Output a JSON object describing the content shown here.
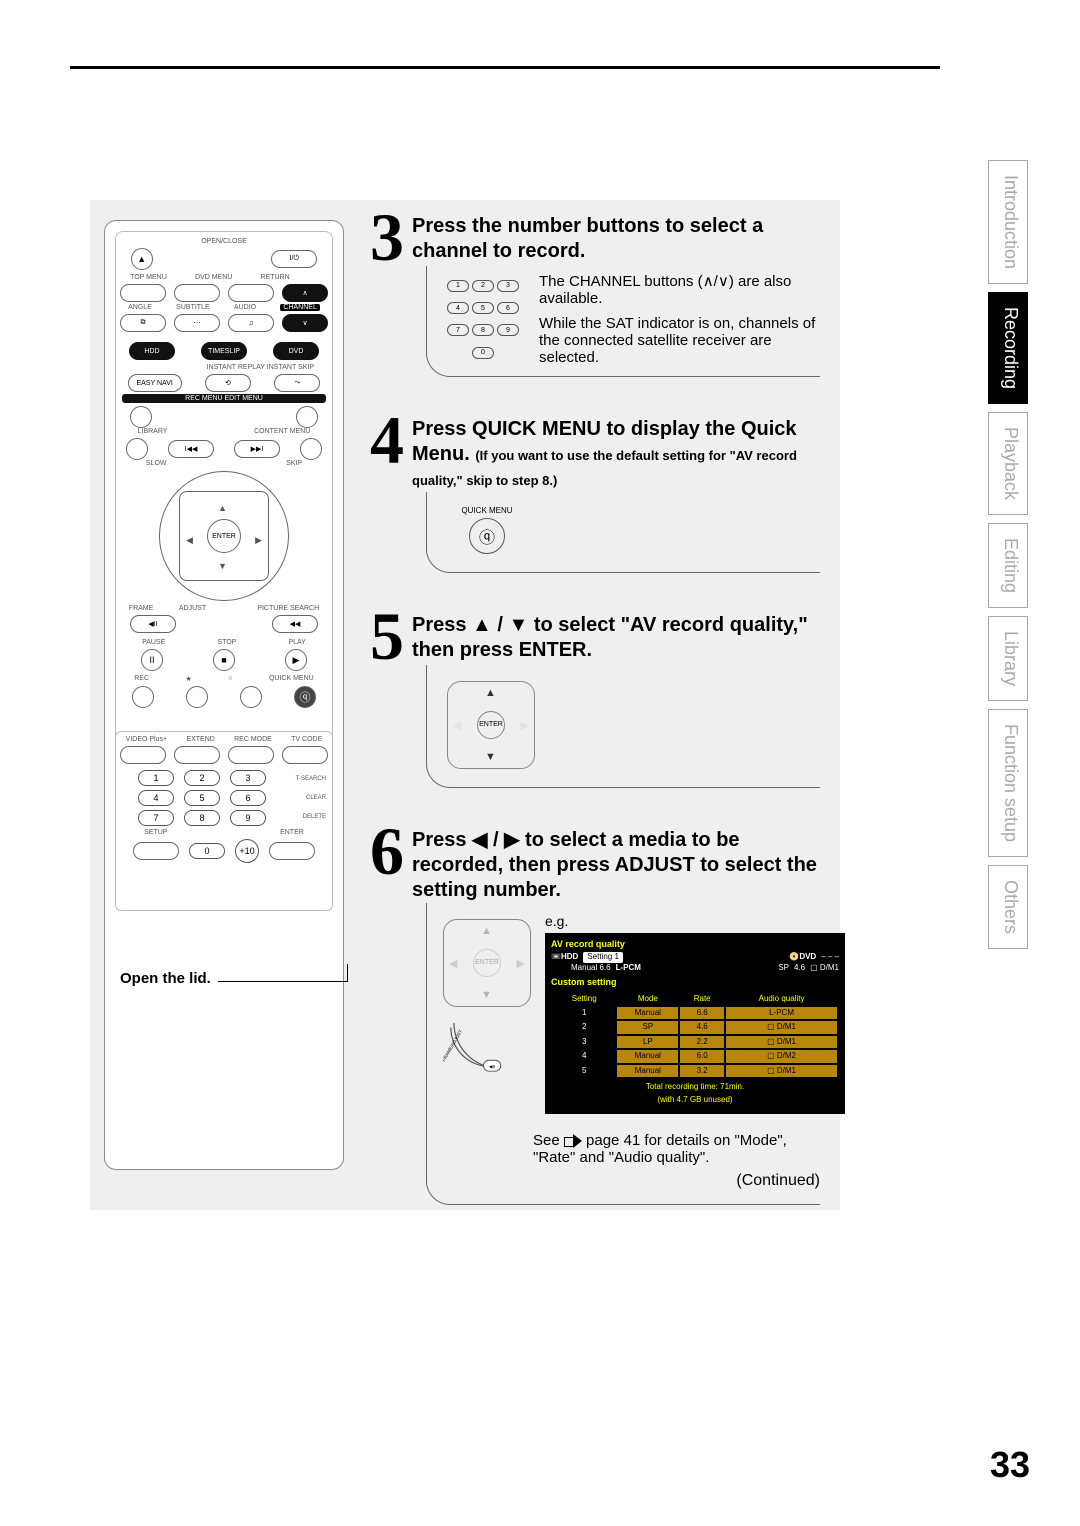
{
  "page_number": "33",
  "tabs": [
    "Introduction",
    "Recording",
    "Playback",
    "Editing",
    "Library",
    "Function setup",
    "Others"
  ],
  "active_tab_index": 1,
  "open_lid": "Open the lid.",
  "remote": {
    "top_labels": [
      "OPEN/CLOSE"
    ],
    "row2_labels": [
      "TOP MENU",
      "DVD MENU",
      "RETURN"
    ],
    "row3_labels": [
      "ANGLE",
      "SUBTITLE",
      "AUDIO",
      "CHANNEL"
    ],
    "drive_labels": [
      "HDD",
      "TIMESLIP",
      "DVD"
    ],
    "replay_label": "INSTANT REPLAY INSTANT SKIP",
    "easynavi": "EASY NAVI",
    "recmenu": "REC MENU  EDIT MENU",
    "library": "LIBRARY",
    "contentmenu": "CONTENT MENU",
    "slow": "SLOW",
    "skip": "SKIP",
    "enter": "ENTER",
    "frame": "FRAME",
    "adjust": "ADJUST",
    "picsearch": "PICTURE SEARCH",
    "transport": [
      "PAUSE",
      "STOP",
      "PLAY"
    ],
    "bottom": [
      "REC",
      "★",
      "○",
      "QUICK MENU"
    ],
    "panel2_head": [
      "VIDEO Plus+",
      "EXTEND",
      "REC MODE",
      "TV CODE"
    ],
    "panel2_side": [
      "T-SEARCH",
      "CLEAR",
      "DELETE"
    ],
    "panel2_foot": [
      "SETUP",
      "ENTER"
    ],
    "numbers": [
      "1",
      "2",
      "3",
      "4",
      "5",
      "6",
      "7",
      "8",
      "9",
      "0",
      "+10"
    ]
  },
  "steps": {
    "s3": {
      "num": "3",
      "title": "Press the number buttons to select a channel to record.",
      "body1": "The CHANNEL buttons (",
      "body1b": ") are also available.",
      "body2": "While the SAT indicator is on, channels of the connected satellite receiver are selected.",
      "numpad": [
        "1",
        "2",
        "3",
        "4",
        "5",
        "6",
        "7",
        "8",
        "9",
        "0"
      ]
    },
    "s4": {
      "num": "4",
      "title_a": "Press QUICK MENU to display the Quick Menu.",
      "title_b": " (If you want to use the default setting for \"AV record quality,\" skip to step 8.)",
      "icon_label": "QUICK MENU"
    },
    "s5": {
      "num": "5",
      "title": "Press ▲ / ▼ to select \"AV record quality,\" then press ENTER.",
      "enter": "ENTER"
    },
    "s6": {
      "num": "6",
      "title": "Press ◀ / ▶ to select a media to be recorded, then press ADJUST to select the setting number.",
      "eg": "e.g.",
      "enter": "ENTER",
      "adjust_lbl": "FRAME/ADJUST",
      "see_a": "See ",
      "see_b": " page 41 for details on \"Mode\", \"Rate\" and \"Audio quality\".",
      "continued": "(Continued)"
    }
  },
  "osd": {
    "title": "AV record quality",
    "hdd": "HDD",
    "setting": "Setting 1",
    "dvd": "DVD",
    "dvd_val": "– – –",
    "line2_a": "Manual 6.6",
    "line2_b": "L-PCM",
    "line2_c": "SP",
    "line2_d": "4.6",
    "line2_e": "D/M1",
    "custom": "Custom setting",
    "headers": [
      "Setting",
      "Mode",
      "Rate",
      "Audio quality"
    ],
    "rows": [
      {
        "n": "1",
        "m": "Manual",
        "r": "6.6",
        "a": "L-PCM"
      },
      {
        "n": "2",
        "m": "SP",
        "r": "4.6",
        "a": "D/M1"
      },
      {
        "n": "3",
        "m": "LP",
        "r": "2.2",
        "a": "D/M1"
      },
      {
        "n": "4",
        "m": "Manual",
        "r": "6.0",
        "a": "D/M2"
      },
      {
        "n": "5",
        "m": "Manual",
        "r": "3.2",
        "a": "D/M1"
      }
    ],
    "foot1": "Total recording time: 71min.",
    "foot2": "(with 4.7 GB unused)"
  }
}
